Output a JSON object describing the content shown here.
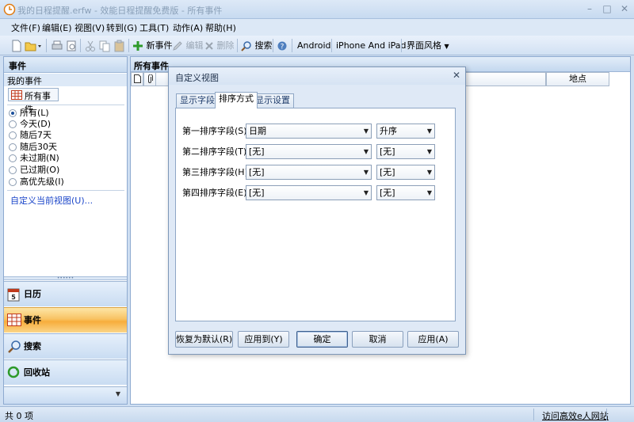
{
  "window": {
    "title": "我的日程提醒.erfw - 效能日程提醒免费版 - 所有事件"
  },
  "menu": [
    "文件(F)",
    "编辑(E)",
    "视图(V)",
    "转到(G)",
    "工具(T)",
    "动作(A)",
    "帮助(H)"
  ],
  "toolbar": {
    "new_event": "新事件",
    "edit": "编辑",
    "delete": "删除",
    "search": "搜索",
    "android": "Android",
    "iphone": "iPhone And iPad",
    "theme": "界面风格"
  },
  "sidebar": {
    "header": "事件",
    "group": "我的事件",
    "all_events": "所有事件",
    "filters": [
      "所有(L)",
      "今天(D)",
      "随后7天",
      "随后30天",
      "未过期(N)",
      "已过期(O)",
      "高优先级(I)"
    ],
    "selected_filter": 0,
    "custom_link": "自定义当前视图(U)...",
    "nav": [
      "日历",
      "事件",
      "搜索",
      "回收站"
    ],
    "active_nav": 1
  },
  "main": {
    "header": "所有事件",
    "column_location": "地点"
  },
  "dialog": {
    "title": "自定义视图",
    "tabs": [
      "显示字段",
      "排序方式",
      "显示设置"
    ],
    "active_tab": 1,
    "rows": [
      {
        "label": "第一排序字段(S):",
        "field": "日期",
        "order": "升序"
      },
      {
        "label": "第二排序字段(T):",
        "field": "[无]",
        "order": "[无]"
      },
      {
        "label": "第三排序字段(H):",
        "field": "[无]",
        "order": "[无]"
      },
      {
        "label": "第四排序字段(E):",
        "field": "[无]",
        "order": "[无]"
      }
    ],
    "buttons": {
      "reset": "恢复为默认(R)",
      "apply_to": "应用到(Y)",
      "ok": "确定",
      "cancel": "取消",
      "apply": "应用(A)"
    }
  },
  "status": {
    "count": "共 0 项",
    "link": "访问高效e人网站"
  },
  "colors": {
    "accent": "#f7ad3b",
    "link": "#1a45c9",
    "chrome": "#cfdff2"
  }
}
